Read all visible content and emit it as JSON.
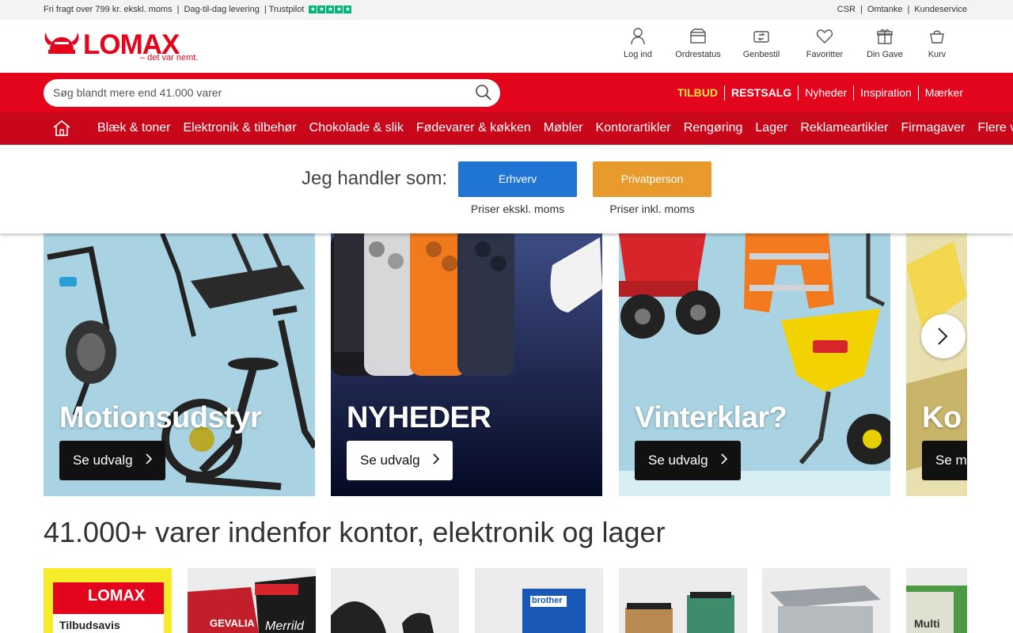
{
  "topbar": {
    "shipping": "Fri fragt over 799 kr. ekskl. moms",
    "sep1": "|",
    "delivery": "Dag-til-dag levering",
    "trustpilot": "| Trustpilot",
    "links": [
      "CSR",
      "|",
      "Omtanke",
      "|",
      "Kundeservice"
    ]
  },
  "header": {
    "logo_text": "LOMAX",
    "logo_tagline": "– det var nemt.",
    "icons": [
      {
        "label": "Log ind",
        "icon": "user-icon"
      },
      {
        "label": "Ordrestatus",
        "icon": "box-icon"
      },
      {
        "label": "Genbestil",
        "icon": "reorder-icon"
      },
      {
        "label": "Favoritter",
        "icon": "heart-icon"
      },
      {
        "label": "Din Gave",
        "icon": "gift-icon"
      },
      {
        "label": "Kurv",
        "icon": "basket-icon"
      }
    ]
  },
  "search": {
    "placeholder": "Søg blandt mere end 41.000 varer"
  },
  "quicklinks": [
    "TILBUD",
    "RESTSALG",
    "Nyheder",
    "Inspiration",
    "Mærker"
  ],
  "nav": [
    "Blæk & toner",
    "Elektronik & tilbehør",
    "Chokolade & slik",
    "Fødevarer & køkken",
    "Møbler",
    "Kontorartikler",
    "Rengøring",
    "Lager",
    "Reklameartikler",
    "Firmagaver",
    "Flere varer"
  ],
  "chooser": {
    "question": "Jeg handler som:",
    "business_label": "Erhverv",
    "private_label": "Privatperson",
    "business_note": "Priser ekskl. moms",
    "private_note": "Priser inkl. moms"
  },
  "banners": [
    {
      "title": "Motionsudstyr",
      "cta": "Se udvalg"
    },
    {
      "title": "NYHEDER",
      "cta": "Se udvalg"
    },
    {
      "title": "Vinterklar?",
      "cta": "Se udvalg"
    },
    {
      "title": "Ko",
      "cta": "Se m"
    }
  ],
  "section_heading": "41.000+ varer indenfor kontor, elektronik og lager",
  "tiles": [
    {
      "label": "LOMAX",
      "sublabel": "Tilbudsavis"
    },
    {
      "label": "GEVALIA",
      "sublabel": "Merrild"
    },
    {
      "label": ""
    },
    {
      "label": "brother"
    },
    {
      "label": ""
    },
    {
      "label": ""
    },
    {
      "label": "Multi"
    }
  ],
  "colors": {
    "brand_red": "#e3051b",
    "nav_red": "#c8071a",
    "business_blue": "#1f74d4",
    "private_orange": "#e99a2c",
    "tilbud_yellow": "#ffe04a"
  }
}
